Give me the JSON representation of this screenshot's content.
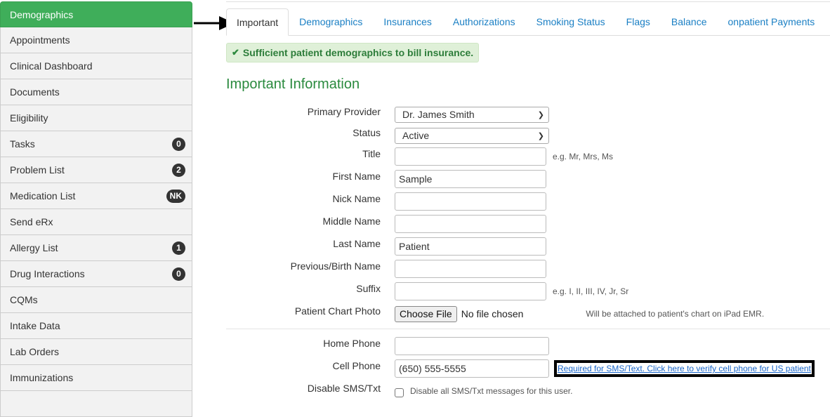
{
  "sidebar": {
    "items": [
      {
        "label": "Demographics",
        "badge": null,
        "active": true
      },
      {
        "label": "Appointments",
        "badge": null
      },
      {
        "label": "Clinical Dashboard",
        "badge": null
      },
      {
        "label": "Documents",
        "badge": null
      },
      {
        "label": "Eligibility",
        "badge": null
      },
      {
        "label": "Tasks",
        "badge": "0"
      },
      {
        "label": "Problem List",
        "badge": "2"
      },
      {
        "label": "Medication List",
        "badge": "NK"
      },
      {
        "label": "Send eRx",
        "badge": null
      },
      {
        "label": "Allergy List",
        "badge": "1"
      },
      {
        "label": "Drug Interactions",
        "badge": "0"
      },
      {
        "label": "CQMs",
        "badge": null
      },
      {
        "label": "Intake Data",
        "badge": null
      },
      {
        "label": "Lab Orders",
        "badge": null
      },
      {
        "label": "Immunizations",
        "badge": null
      },
      {
        "label": "",
        "badge": null
      }
    ]
  },
  "tabs": [
    {
      "label": "Important",
      "active": true
    },
    {
      "label": "Demographics"
    },
    {
      "label": "Insurances"
    },
    {
      "label": "Authorizations"
    },
    {
      "label": "Smoking Status"
    },
    {
      "label": "Flags"
    },
    {
      "label": "Balance"
    },
    {
      "label": "onpatient Payments"
    }
  ],
  "alert": {
    "icon": "check-icon",
    "glyph": "✔",
    "text": "Sufficient patient demographics to bill insurance."
  },
  "section_title": "Important Information",
  "form": {
    "primary_provider": {
      "label": "Primary Provider",
      "value": "Dr. James Smith"
    },
    "status": {
      "label": "Status",
      "value": "Active"
    },
    "title": {
      "label": "Title",
      "value": "",
      "hint": "e.g. Mr, Mrs, Ms"
    },
    "first_name": {
      "label": "First Name",
      "value": "Sample"
    },
    "nick_name": {
      "label": "Nick Name",
      "value": ""
    },
    "middle_name": {
      "label": "Middle Name",
      "value": ""
    },
    "last_name": {
      "label": "Last Name",
      "value": "Patient"
    },
    "previous_name": {
      "label": "Previous/Birth Name",
      "value": ""
    },
    "suffix": {
      "label": "Suffix",
      "value": "",
      "hint": "e.g. I, II, III, IV, Jr, Sr"
    },
    "chart_photo": {
      "label": "Patient Chart Photo",
      "button": "Choose File",
      "status": "No file chosen",
      "hint": "Will be attached to patient's chart on iPad EMR."
    },
    "home_phone": {
      "label": "Home Phone",
      "value": ""
    },
    "cell_phone": {
      "label": "Cell Phone",
      "value": "(650) 555-5555",
      "verify_link": "Required for SMS/Text. Click here to verify cell phone for US patient"
    },
    "disable_sms": {
      "label": "Disable SMS/Txt",
      "checked": false,
      "text": "Disable all SMS/Txt messages for this user."
    }
  },
  "colors": {
    "accent_green": "#3fae5a",
    "link_blue": "#1a7fc4",
    "heading_green": "#2a8a3e",
    "alert_bg": "#dff0d8"
  }
}
